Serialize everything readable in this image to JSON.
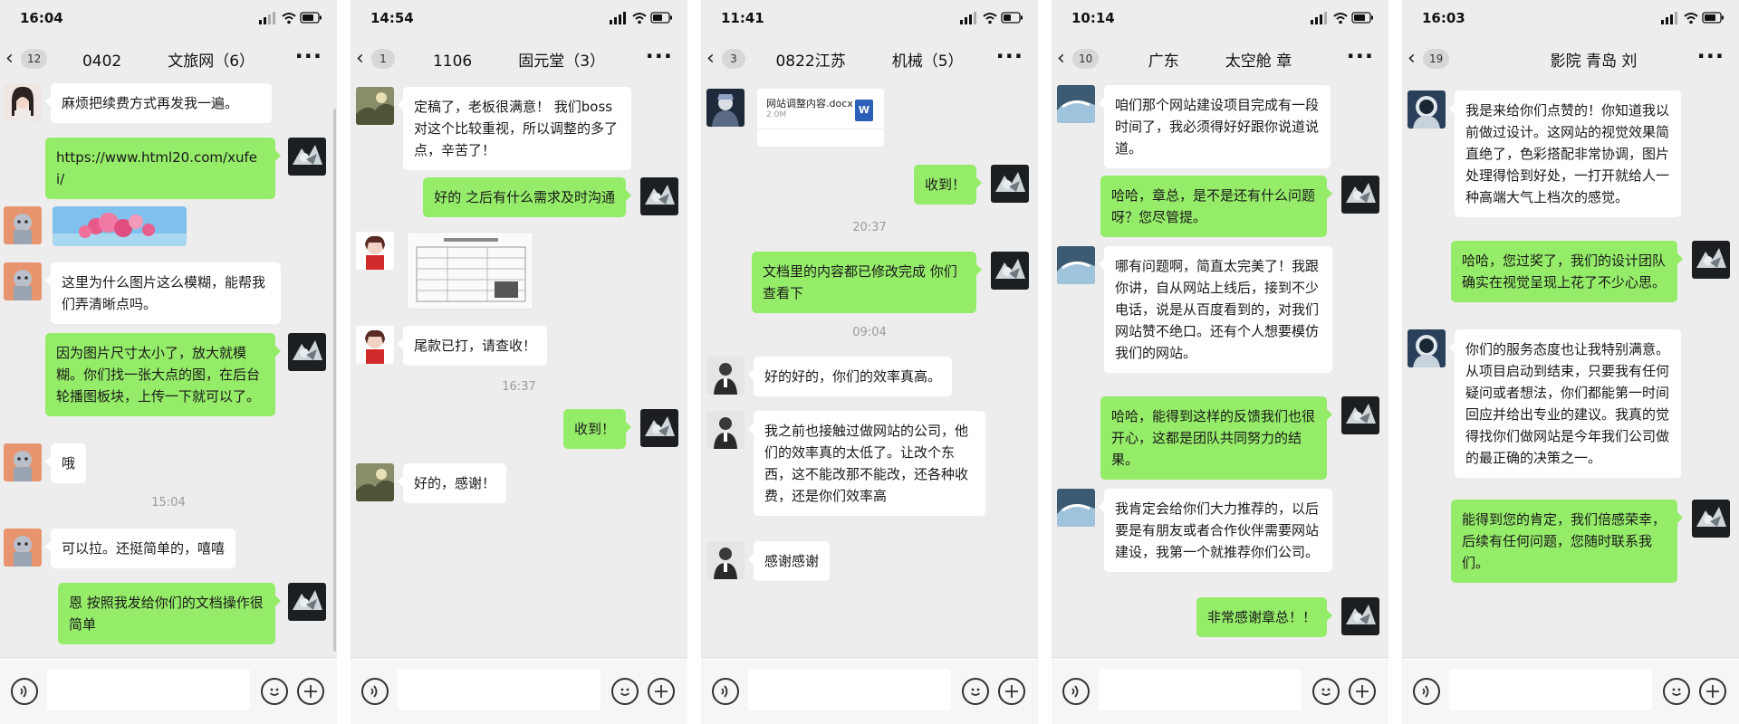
{
  "phones": [
    {
      "time": "16:04",
      "unread": "12",
      "title": "0402   文旅网（6）",
      "messages": [
        "麻烦把续费方式再发我一遍。",
        "https://www.html20.com/xufei/",
        "这里为什么图片这么模糊，能帮我们弄清晰点吗。",
        "因为图片尺寸太小了，放大就模糊。你们找一张大点的图，在后台轮播图板块，上传一下就可以了。",
        "哦",
        "可以拉。还挺简单的，嘻嘻",
        "恩 按照我发给你们的文档操作很简单"
      ],
      "timestamps": [
        "15:04"
      ]
    },
    {
      "time": "14:54",
      "unread": "1",
      "title": "1106   固元堂（3）",
      "messages": [
        "定稿了，老板很满意！ 我们boss对这个比较重视，所以调整的多了点，辛苦了！",
        "好的 之后有什么需求及时沟通",
        "尾款已打，请查收！",
        "收到！",
        "好的，感谢！"
      ],
      "timestamps": [
        "16:37"
      ]
    },
    {
      "time": "11:41",
      "unread": "3",
      "title": "0822江苏   机械（5）",
      "file": {
        "name": "网站调整内容.docx",
        "size": "2.0M",
        "badge": "W"
      },
      "messages": [
        "收到！",
        "文档里的内容都已修改完成 你们查看下",
        "好的好的，你们的效率真高。",
        "我之前也接触过做网站的公司，他们的效率真的太低了。让改个东西，这不能改那不能改，还各种收费，还是你们效率高",
        "感谢感谢"
      ],
      "timestamps": [
        "20:37",
        "09:04"
      ]
    },
    {
      "time": "10:14",
      "unread": "10",
      "title": "广东   太空舱 章",
      "messages": [
        "咱们那个网站建设项目完成有一段时间了，我必须得好好跟你说道说道。",
        "哈哈，章总，是不是还有什么问题呀？您尽管提。",
        "哪有问题啊，简直太完美了！我跟你讲，自从网站上线后，接到不少电话，说是从百度看到的，对我们网站赞不绝口。还有个人想要模仿我们的网站。",
        "哈哈，能得到这样的反馈我们也很开心，这都是团队共同努力的结果。",
        "我肯定会给你们大力推荐的，以后要是有朋友或者合作伙伴需要网站建设，我第一个就推荐你们公司。",
        "非常感谢章总！！"
      ],
      "timestamps": []
    },
    {
      "time": "16:03",
      "unread": "19",
      "title": "   影院 青岛 刘",
      "messages": [
        "我是来给你们点赞的！你知道我以前做过设计。这网站的视觉效果简直绝了，色彩搭配非常协调，图片处理得恰到好处，一打开就给人一种高端大气上档次的感觉。",
        "哈哈，您过奖了，我们的设计团队确实在视觉呈现上花了不少心思。",
        "你们的服务态度也让我特别满意。从项目启动到结束，只要我有任何疑问或者想法，你们都能第一时间回应并给出专业的建议。我真的觉得找你们做网站是今年我们公司做的最正确的决策之一。",
        "能得到您的肯定，我们倍感荣幸，后续有任何问题，您随时联系我们。"
      ],
      "timestamps": []
    }
  ],
  "colors": {
    "bubble_out": "#95ec69",
    "bubble_in": "#ffffff",
    "chat_bg": "#ededed"
  },
  "icons": [
    "back-chevron-icon",
    "more-icon",
    "voice-icon",
    "emoji-icon",
    "plus-icon",
    "signal-icon",
    "wifi-icon",
    "battery-icon"
  ]
}
